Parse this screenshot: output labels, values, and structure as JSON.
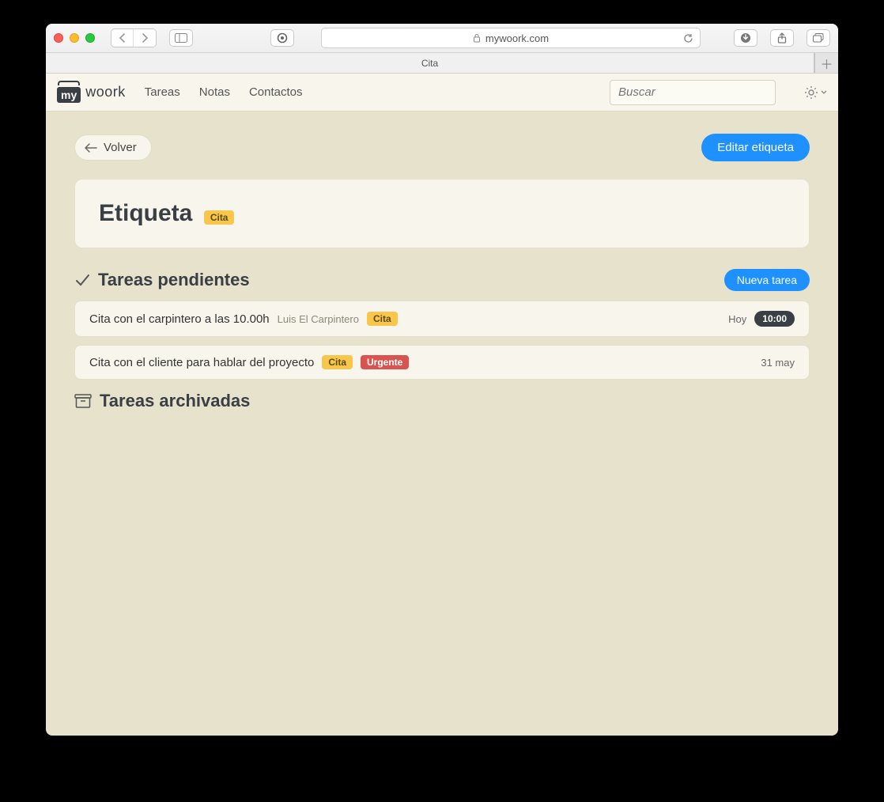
{
  "browser": {
    "url_host": "mywoork.com",
    "tab_title": "Cita"
  },
  "nav": {
    "logo_prefix": "my",
    "logo_suffix": "woork",
    "links": [
      "Tareas",
      "Notas",
      "Contactos"
    ],
    "search_placeholder": "Buscar"
  },
  "actions": {
    "back_label": "Volver",
    "edit_label": "Editar etiqueta",
    "new_task_label": "Nueva tarea"
  },
  "header": {
    "title": "Etiqueta",
    "tag": "Cita"
  },
  "sections": {
    "pending_title": "Tareas pendientes",
    "archived_title": "Tareas archivadas"
  },
  "tasks": [
    {
      "title": "Cita con el carpintero a las 10.00h",
      "contact": "Luis El Carpintero",
      "tags": [
        {
          "text": "Cita",
          "color": "yellow"
        }
      ],
      "date": "Hoy",
      "time": "10:00"
    },
    {
      "title": "Cita con el cliente para hablar del proyecto",
      "contact": "",
      "tags": [
        {
          "text": "Cita",
          "color": "yellow"
        },
        {
          "text": "Urgente",
          "color": "red"
        }
      ],
      "date": "31 may",
      "time": ""
    }
  ]
}
